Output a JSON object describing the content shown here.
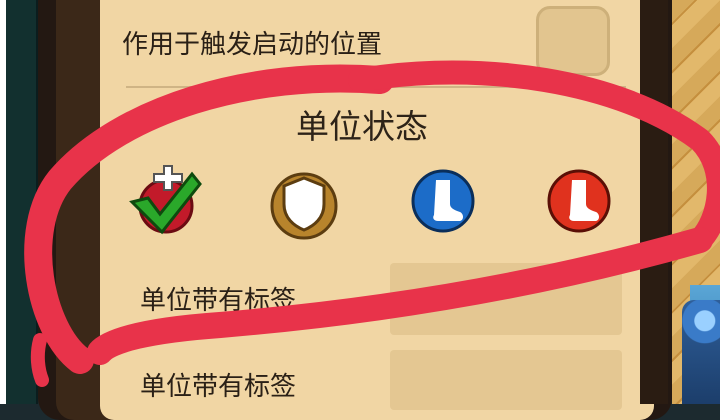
{
  "panel": {
    "trigger_label": "作用于触发启动的位置",
    "status_title": "单位状态",
    "tag_label_1": "单位带有标签",
    "tag_label_2": "单位带有标签"
  },
  "status_icons": [
    "check-heal-icon",
    "shield-icon",
    "blue-foot-icon",
    "red-foot-icon"
  ],
  "colors": {
    "panel": "#f1d6a4",
    "frame": "#231812",
    "scribble": "#e8334a"
  }
}
